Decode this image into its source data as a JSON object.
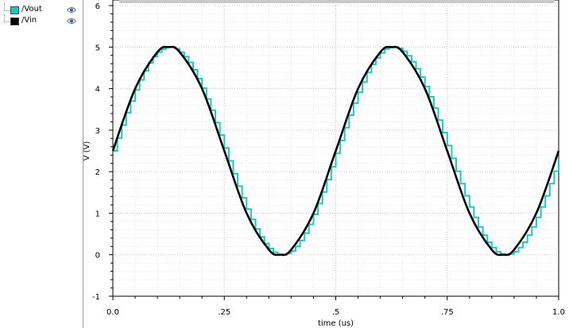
{
  "legend": {
    "items": [
      {
        "label": "/Vout",
        "color": "#1fc7c4",
        "icon": "eye-icon"
      },
      {
        "label": "/Vin",
        "color": "#000000",
        "icon": "eye-icon"
      }
    ]
  },
  "chart_data": {
    "type": "line",
    "xlabel": "time (us)",
    "ylabel": "V (V)",
    "xlim": [
      0,
      1.0
    ],
    "ylim": [
      -1,
      6
    ],
    "x_ticks": [
      {
        "value": 0,
        "label": "0.0"
      },
      {
        "value": 0.25,
        "label": ".25"
      },
      {
        "value": 0.5,
        "label": ".5"
      },
      {
        "value": 0.75,
        "label": ".75"
      },
      {
        "value": 1.0,
        "label": "1.0"
      }
    ],
    "y_ticks": [
      {
        "value": -1,
        "label": "-1"
      },
      {
        "value": 0,
        "label": "0"
      },
      {
        "value": 1,
        "label": "1"
      },
      {
        "value": 2,
        "label": "2"
      },
      {
        "value": 3,
        "label": "3"
      },
      {
        "value": 4,
        "label": "4"
      },
      {
        "value": 5,
        "label": "5"
      },
      {
        "value": 6,
        "label": "6"
      }
    ],
    "grid": true,
    "series": [
      {
        "name": "/Vin",
        "color": "#000000",
        "style": "line",
        "x": [
          0,
          0.05,
          0.1,
          0.125,
          0.15,
          0.2,
          0.25,
          0.3,
          0.35,
          0.375,
          0.4,
          0.45,
          0.5,
          0.55,
          0.6,
          0.625,
          0.65,
          0.7,
          0.75,
          0.8,
          0.85,
          0.875,
          0.9,
          0.95,
          1.0
        ],
        "y": [
          2.5,
          4.0,
          4.88,
          5.0,
          4.88,
          4.0,
          2.5,
          1.0,
          0.12,
          0.0,
          0.12,
          1.0,
          2.5,
          4.0,
          4.88,
          5.0,
          4.88,
          4.0,
          2.5,
          1.0,
          0.12,
          0.0,
          0.12,
          1.0,
          2.5
        ]
      },
      {
        "name": "/Vout",
        "color": "#1fc7c4",
        "style": "step",
        "x": [
          0,
          0.01,
          0.02,
          0.03,
          0.04,
          0.05,
          0.06,
          0.07,
          0.08,
          0.09,
          0.1,
          0.11,
          0.12,
          0.13,
          0.14,
          0.15,
          0.16,
          0.17,
          0.18,
          0.19,
          0.2,
          0.21,
          0.22,
          0.23,
          0.24,
          0.25,
          0.26,
          0.27,
          0.28,
          0.29,
          0.3,
          0.31,
          0.32,
          0.33,
          0.34,
          0.35,
          0.36,
          0.37,
          0.38,
          0.39,
          0.4,
          0.41,
          0.42,
          0.43,
          0.44,
          0.45,
          0.46,
          0.47,
          0.48,
          0.49,
          0.5,
          0.51,
          0.52,
          0.53,
          0.54,
          0.55,
          0.56,
          0.57,
          0.58,
          0.59,
          0.6,
          0.61,
          0.62,
          0.63,
          0.64,
          0.65,
          0.66,
          0.67,
          0.68,
          0.69,
          0.7,
          0.71,
          0.72,
          0.73,
          0.74,
          0.75,
          0.76,
          0.77,
          0.78,
          0.79,
          0.8,
          0.81,
          0.82,
          0.83,
          0.84,
          0.85,
          0.86,
          0.87,
          0.88,
          0.89,
          0.9,
          0.91,
          0.92,
          0.93,
          0.94,
          0.95,
          0.96,
          0.97,
          0.98,
          0.99,
          1.0
        ],
        "y": [
          2.5,
          2.81,
          3.12,
          3.42,
          3.7,
          3.97,
          4.21,
          4.43,
          4.62,
          4.77,
          4.88,
          4.95,
          5.0,
          5.0,
          4.96,
          4.88,
          4.77,
          4.63,
          4.45,
          4.24,
          4.01,
          3.75,
          3.48,
          3.18,
          2.88,
          2.57,
          2.26,
          1.95,
          1.65,
          1.37,
          1.1,
          0.85,
          0.62,
          0.43,
          0.27,
          0.15,
          0.06,
          0.01,
          0.0,
          0.03,
          0.09,
          0.2,
          0.34,
          0.52,
          0.73,
          0.97,
          1.23,
          1.51,
          1.81,
          2.12,
          2.44,
          2.75,
          3.06,
          3.36,
          3.65,
          3.91,
          4.16,
          4.39,
          4.58,
          4.74,
          4.86,
          4.95,
          4.99,
          5.0,
          4.97,
          4.9,
          4.79,
          4.65,
          4.48,
          4.28,
          4.05,
          3.8,
          3.53,
          3.24,
          2.94,
          2.63,
          2.32,
          2.01,
          1.71,
          1.42,
          1.15,
          0.9,
          0.67,
          0.47,
          0.3,
          0.17,
          0.07,
          0.02,
          0.0,
          0.02,
          0.07,
          0.17,
          0.3,
          0.47,
          0.67,
          0.9,
          1.15,
          1.42,
          1.71,
          2.01,
          2.32
        ]
      }
    ]
  }
}
